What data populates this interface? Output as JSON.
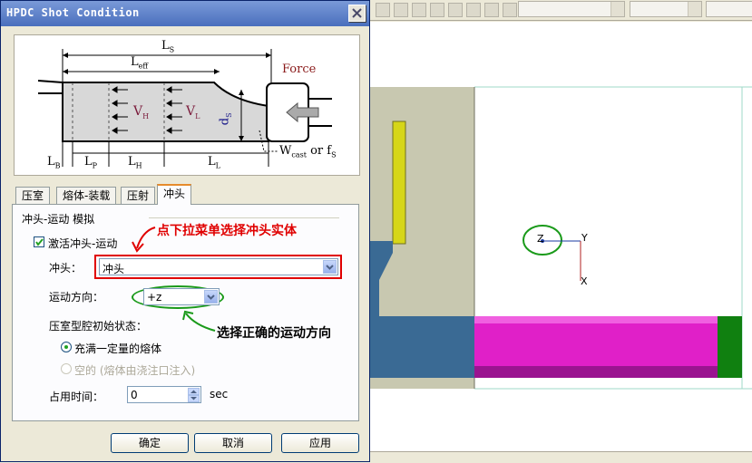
{
  "dialog": {
    "title": "HPDC Shot Condition",
    "close_glyph": "✕",
    "diagram": {
      "ls": "L",
      "ls_sub": "S",
      "leff": "L",
      "leff_sub": "eff",
      "force": "Force",
      "vh": "V",
      "vh_sub": "H",
      "vl": "V",
      "vl_sub": "L",
      "ds": "d",
      "ds_sub": "S",
      "lb": "L",
      "lb_sub": "B",
      "lp": "L",
      "lp_sub": "P",
      "lh": "L",
      "lh_sub": "H",
      "ll": "L",
      "ll_sub": "L",
      "wcast": "W",
      "wcast_sub": "cast",
      "or": "or",
      "fs": "f",
      "fs_sub": "S"
    },
    "tabs": [
      "压室",
      "熔体-装载",
      "压射",
      "冲头"
    ],
    "active_tab": 3,
    "panel": {
      "group_title": "冲头-运动 模拟",
      "activate_label": "激活冲头-运动",
      "activate_checked": true,
      "plunger_label": "冲头：",
      "plunger_value": "冲头",
      "direction_label": "运动方向：",
      "direction_value": "+z",
      "initial_state_label": "压室型腔初始状态：",
      "radio_full": "充满一定量的熔体",
      "radio_full_selected": true,
      "radio_empty": "空的 (熔体由浇注口注入)",
      "occupy_label": "占用时间：",
      "occupy_value": "0",
      "occupy_unit": "sec"
    },
    "buttons": {
      "ok": "确定",
      "cancel": "取消",
      "apply": "应用"
    }
  },
  "annotations": {
    "note1": "点下拉菜单选择冲头实体",
    "note2": "选择正确的运动方向"
  },
  "viewport": {
    "axis_z": "Z",
    "axis_y": "Y",
    "axis_x": "X"
  },
  "colors": {
    "title_bar": "#4a6fbd",
    "annotation_red": "#e00000",
    "annotation_green": "#1a9a1a",
    "plunger_magenta": "#e020c8",
    "die_olive": "#c8c8b0",
    "chamber_blue": "#3a6a94",
    "yellow_part": "#d6d618",
    "green_part": "#108010"
  }
}
